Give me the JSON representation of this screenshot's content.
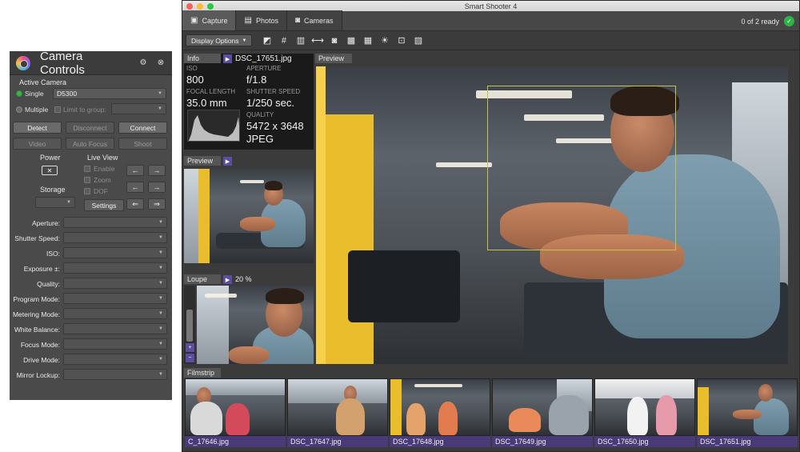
{
  "camera_controls": {
    "title": "Camera Controls",
    "active_camera_label": "Active Camera",
    "single_label": "Single",
    "single_value": "D5300",
    "multiple_label": "Multiple",
    "limit_group_label": "Limit to group:",
    "buttons": {
      "detect": "Detect",
      "disconnect": "Disconnect",
      "connect": "Connect",
      "video": "Video",
      "autofocus": "Auto Focus",
      "shoot": "Shoot",
      "settings": "Settings"
    },
    "power_label": "Power",
    "storage_label": "Storage",
    "live_view_label": "Live View",
    "live_view_options": {
      "enable": "Enable",
      "zoom": "Zoom",
      "dof": "DOF"
    },
    "properties": [
      "Aperture:",
      "Shutter Speed:",
      "ISO:",
      "Exposure ±:",
      "Quality:",
      "Program Mode:",
      "Metering Mode:",
      "White Balance:",
      "Focus Mode:",
      "Drive Mode:",
      "Mirror Lockup:"
    ]
  },
  "app": {
    "window_title": "Smart Shooter 4",
    "tabs": [
      "Capture",
      "Photos",
      "Cameras"
    ],
    "status": "0 of 2 ready",
    "display_options": "Display Options",
    "info": {
      "title": "Info",
      "filename": "DSC_17651.jpg",
      "iso_label": "ISO",
      "iso": "800",
      "aperture_label": "APERTURE",
      "aperture": "f/1.8",
      "focal_label": "FOCAL LENGTH",
      "focal": "35.0 mm",
      "shutter_label": "SHUTTER SPEED",
      "shutter": "1/250 sec.",
      "quality_label": "QUALITY",
      "resolution": "5472 x 3648",
      "format": "JPEG"
    },
    "preview_small_title": "Preview",
    "loupe_title": "Loupe",
    "loupe_zoom": "20 %",
    "main_preview_title": "Preview",
    "filmstrip_title": "Filmstrip",
    "filmstrip": [
      "C_17646.jpg",
      "DSC_17647.jpg",
      "DSC_17648.jpg",
      "DSC_17649.jpg",
      "DSC_17650.jpg",
      "DSC_17651.jpg"
    ]
  },
  "colors": {
    "accent_purple": "#5b4ea0",
    "ready_green": "#2fb344",
    "panel_bg": "#4a4a4a"
  }
}
